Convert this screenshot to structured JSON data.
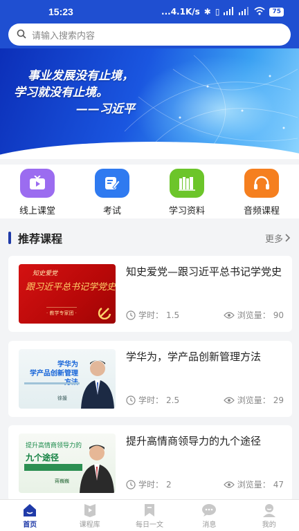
{
  "status_bar": {
    "time": "15:23",
    "network_speed": "...4.1K/s",
    "battery": "75"
  },
  "search": {
    "placeholder": "请输入搜索内容"
  },
  "banner": {
    "line1": "事业发展没有止境，",
    "line2": "学习就没有止境。",
    "line3": "——习近平"
  },
  "quick_links": [
    {
      "label": "线上课堂",
      "icon": "tv-icon",
      "color": "#9b6cf0"
    },
    {
      "label": "考试",
      "icon": "edit-icon",
      "color": "#2f7af0"
    },
    {
      "label": "学习资料",
      "icon": "books-icon",
      "color": "#6cc52a"
    },
    {
      "label": "音频课程",
      "icon": "headphones-icon",
      "color": "#f57f1f"
    }
  ],
  "section": {
    "title": "推荐课程",
    "more": "更多"
  },
  "courses": [
    {
      "title": "知史爱党—跟习近平总书记学党史",
      "hours_label": "学时：",
      "hours": "1.5",
      "views_label": "浏览量：",
      "views": "90",
      "thumb": {
        "sub": "知史爱党",
        "main": "跟习近平总书记学党史",
        "foot": "· 教学专家团 ·"
      }
    },
    {
      "title": "学华为，学产品创新管理方法",
      "hours_label": "学时：",
      "hours": "2.5",
      "views_label": "浏览量：",
      "views": "29",
      "thumb": {
        "main": "学华为\n学产品创新管理方法",
        "name": "徐援"
      }
    },
    {
      "title": "提升高情商领导力的九个途径",
      "hours_label": "学时：",
      "hours": "2",
      "views_label": "浏览量：",
      "views": "47",
      "thumb": {
        "sub": "提升高情商领导力的",
        "main": "九个途径",
        "name": "蒋巍巍"
      }
    }
  ],
  "tabbar": [
    {
      "label": "首页",
      "icon": "home-icon",
      "active": true
    },
    {
      "label": "课程库",
      "icon": "video-icon",
      "active": false
    },
    {
      "label": "每日一文",
      "icon": "bookmark-icon",
      "active": false
    },
    {
      "label": "消息",
      "icon": "message-icon",
      "active": false
    },
    {
      "label": "我的",
      "icon": "user-icon",
      "active": false
    }
  ],
  "colors": {
    "primary": "#1f4fd1",
    "nav_active": "#1f3aa8"
  }
}
